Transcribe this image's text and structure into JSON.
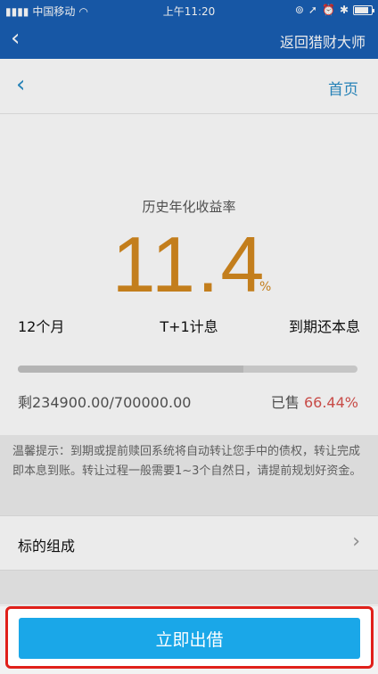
{
  "status_bar": {
    "carrier": "中国移动",
    "time": "上午11:20",
    "battery_level": 0.85
  },
  "app_bar": {
    "back_icon": "chevron-left-icon",
    "return_label": "返回猎财大师"
  },
  "sub_nav": {
    "back_icon": "chevron-left-icon",
    "home_label": "首页"
  },
  "product": {
    "rate_label": "历史年化收益率",
    "rate_value": "11.4",
    "rate_unit": "%",
    "term": "12个月",
    "interest_rule": "T+1计息",
    "repayment": "到期还本息",
    "remaining_text": "剩234900.00/700000.00",
    "sold_label": "已售",
    "sold_percent": "66.44%",
    "progress_fraction": 0.6644
  },
  "tip": {
    "text": "温馨提示：到期或提前赎回系统将自动转让您手中的债权，转让完成即本息到账。转让过程一般需要1~3个自然日，请提前规划好资金。"
  },
  "composition": {
    "label": "标的组成"
  },
  "cta": {
    "label": "立即出借"
  },
  "colors": {
    "header_blue": "#1a5fb4",
    "accent_orange": "#d4891f",
    "link_blue": "#2a8ec7",
    "sold_red": "#d9534f",
    "cta_blue": "#1aa7e8",
    "highlight_red": "#e0201a"
  }
}
